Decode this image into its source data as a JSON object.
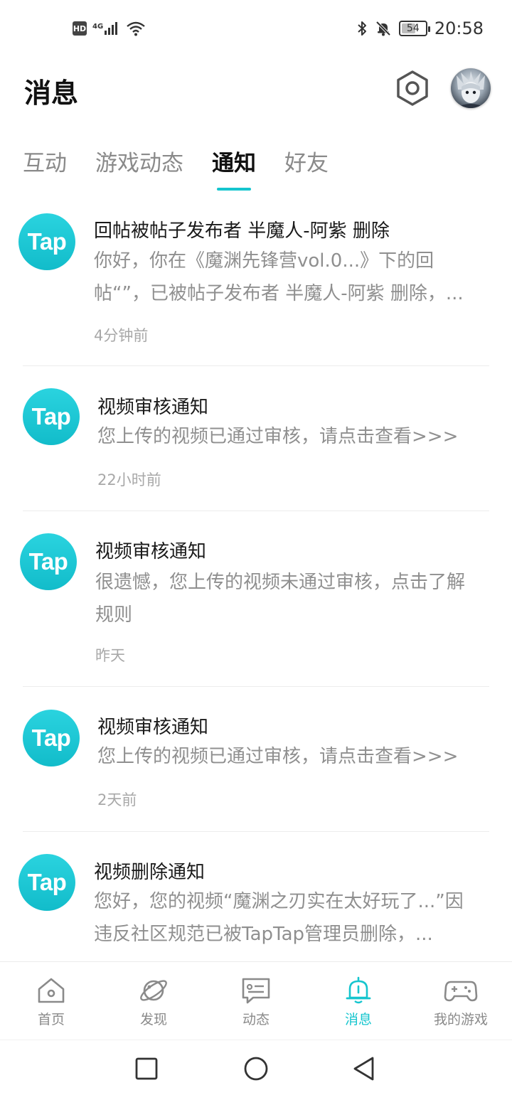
{
  "status_bar": {
    "hd": "HD",
    "network": "4G",
    "battery": "54",
    "time": "20:58"
  },
  "header": {
    "title": "消息"
  },
  "tabs": [
    {
      "label": "互动",
      "active": false
    },
    {
      "label": "游戏动态",
      "active": false
    },
    {
      "label": "通知",
      "active": true
    },
    {
      "label": "好友",
      "active": false
    }
  ],
  "notifications": [
    {
      "logo": "Tap",
      "title": "回帖被帖子发布者 半魔人-阿紫 删除",
      "body": "你好，你在《魔渊先锋营vol.0...》下的回帖“”，已被帖子发布者 半魔人-阿紫 删除，...",
      "time": "4分钟前"
    },
    {
      "logo": "Tap",
      "title": "视频审核通知",
      "body": "您上传的视频已通过审核，请点击查看>>>",
      "time": "22小时前"
    },
    {
      "logo": "Tap",
      "title": "视频审核通知",
      "body": "很遗憾，您上传的视频未通过审核，点击了解规则",
      "time": "昨天"
    },
    {
      "logo": "Tap",
      "title": "视频审核通知",
      "body": "您上传的视频已通过审核，请点击查看>>>",
      "time": "2天前"
    },
    {
      "logo": "Tap",
      "title": "视频删除通知",
      "body": "您好，您的视频“魔渊之刃实在太好玩了...”因违反社区规范已被TapTap管理员删除，...",
      "time": ""
    }
  ],
  "bottom_nav": [
    {
      "label": "首页",
      "icon": "home-icon",
      "active": false
    },
    {
      "label": "发现",
      "icon": "planet-icon",
      "active": false
    },
    {
      "label": "动态",
      "icon": "feed-icon",
      "active": false
    },
    {
      "label": "消息",
      "icon": "bell-icon",
      "active": true
    },
    {
      "label": "我的游戏",
      "icon": "gamepad-icon",
      "active": false
    }
  ],
  "colors": {
    "accent": "#15c5ce",
    "tap_logo": "#1ec8d4",
    "muted_text": "#8f8f8f"
  }
}
